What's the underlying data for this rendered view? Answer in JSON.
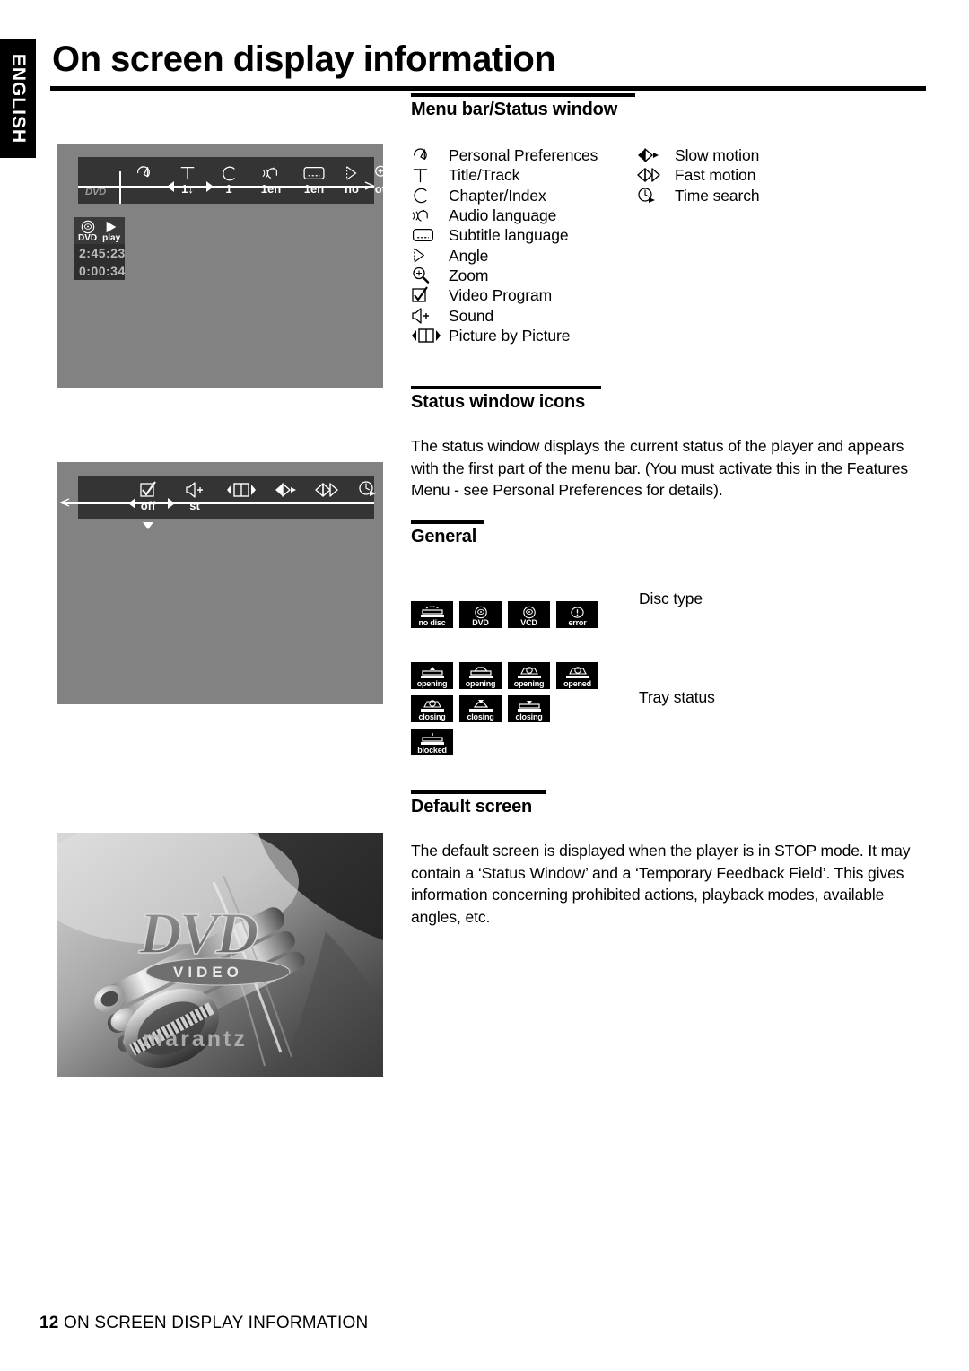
{
  "lang_tab": "ENGLISH",
  "page_title": "On screen display information",
  "sections": {
    "menu_bar": {
      "heading": "Menu bar/Status window"
    },
    "status_icons": {
      "heading": "Status window icons",
      "paragraph": "The status window displays the current status of the player and appears with the first part of the menu bar. (You must activate this in the Features Menu - see Personal Preferences for details)."
    },
    "general": {
      "heading": "General",
      "disc_type_label": "Disc type",
      "tray_status_label": "Tray status"
    },
    "default_screen": {
      "heading": "Default screen",
      "paragraph": "The default screen is displayed when the player is in STOP mode. It may contain a ‘Status Window’ and a ‘Temporary Feedback Field’. This gives information concerning prohibited actions, playback modes, available angles, etc."
    }
  },
  "legend_left": [
    {
      "icon": "personal-preferences-icon",
      "label": "Personal Preferences"
    },
    {
      "icon": "title-track-icon",
      "label": "Title/Track"
    },
    {
      "icon": "chapter-index-icon",
      "label": "Chapter/Index"
    },
    {
      "icon": "audio-language-icon",
      "label": "Audio language"
    },
    {
      "icon": "subtitle-language-icon",
      "label": "Subtitle language"
    },
    {
      "icon": "angle-icon",
      "label": "Angle"
    },
    {
      "icon": "zoom-icon",
      "label": "Zoom"
    },
    {
      "icon": "video-program-icon",
      "label": "Video Program"
    },
    {
      "icon": "sound-icon",
      "label": "Sound"
    },
    {
      "icon": "picture-by-picture-icon",
      "label": "Picture by Picture"
    }
  ],
  "legend_right": [
    {
      "icon": "slow-motion-icon",
      "label": "Slow motion"
    },
    {
      "icon": "fast-motion-icon",
      "label": "Fast motion"
    },
    {
      "icon": "time-search-icon",
      "label": "Time search"
    }
  ],
  "screenshot_menu_bar": {
    "disc_badge": "DVD",
    "cells": [
      {
        "icon": "personal-preferences-icon",
        "value": ""
      },
      {
        "icon": "title-track-icon",
        "value": "1↕"
      },
      {
        "icon": "chapter-index-icon",
        "value": "1"
      },
      {
        "icon": "audio-language-icon",
        "value": "1en"
      },
      {
        "icon": "subtitle-language-icon",
        "value": "1en"
      },
      {
        "icon": "angle-icon",
        "value": "no"
      },
      {
        "icon": "zoom-icon",
        "value": "off"
      }
    ],
    "status_window": {
      "disc_label": "DVD",
      "mode_label": "play",
      "total_time": "2:45:23",
      "elapsed_time": "0:00:34"
    }
  },
  "screenshot_menu_bar2": {
    "cells": [
      {
        "icon": "video-program-icon",
        "value": "off"
      },
      {
        "icon": "sound-icon",
        "value": "st"
      },
      {
        "icon": "picture-by-picture-icon",
        "value": ""
      },
      {
        "icon": "slow-motion-icon",
        "value": ""
      },
      {
        "icon": "fast-motion-icon",
        "value": ""
      },
      {
        "icon": "time-search-icon",
        "value": ""
      }
    ]
  },
  "disc_type_badges": [
    {
      "icon": "tray-no-disc-icon",
      "label": "no disc"
    },
    {
      "icon": "disc-dvd-icon",
      "label": "DVD"
    },
    {
      "icon": "disc-vcd-icon",
      "label": "VCD"
    },
    {
      "icon": "error-icon",
      "label": "error"
    }
  ],
  "tray_badges_row1": [
    {
      "icon": "tray-opening-1-icon",
      "label": "opening"
    },
    {
      "icon": "tray-opening-2-icon",
      "label": "opening"
    },
    {
      "icon": "tray-opening-3-icon",
      "label": "opening"
    },
    {
      "icon": "tray-opened-icon",
      "label": "opened"
    }
  ],
  "tray_badges_row2": [
    {
      "icon": "tray-closing-1-icon",
      "label": "closing"
    },
    {
      "icon": "tray-closing-2-icon",
      "label": "closing"
    },
    {
      "icon": "tray-closing-3-icon",
      "label": "closing"
    }
  ],
  "tray_badges_row3": [
    {
      "icon": "tray-blocked-icon",
      "label": "blocked"
    }
  ],
  "default_screen_photo": {
    "logo_main": "DVD",
    "logo_sub": "VIDEO",
    "brand": "marantz"
  },
  "footer": {
    "page_number": "12",
    "title": "ON SCREEN DISPLAY INFORMATION"
  },
  "colors": {
    "screen_background": "#828282",
    "menu_bar": "#343434",
    "status_window_time": "#2e2e2e",
    "text": "#000000"
  }
}
